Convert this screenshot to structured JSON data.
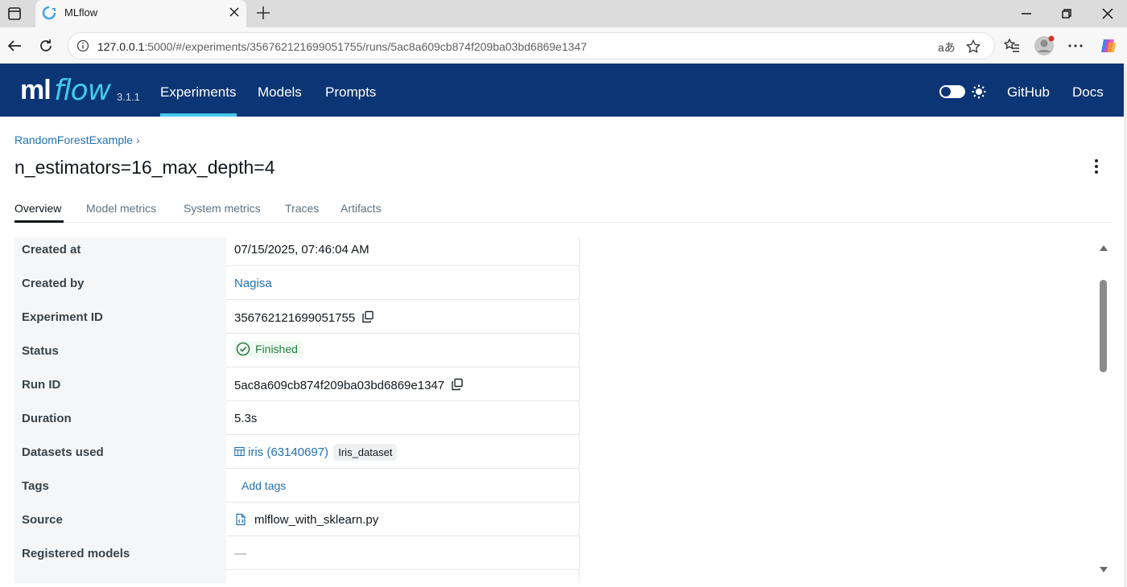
{
  "browser": {
    "tab_title": "MLflow",
    "url_host": "127.0.0.1",
    "url_rest": ":5000/#/experiments/356762121699051755/runs/5ac8a609cb874f209ba03bd6869e1347",
    "translate_label": "aあ"
  },
  "header": {
    "logo_ml": "ml",
    "logo_flow": "flow",
    "version": "3.1.1",
    "nav": [
      "Experiments",
      "Models",
      "Prompts"
    ],
    "links": {
      "github": "GitHub",
      "docs": "Docs"
    },
    "accent_color": "#43c9ed",
    "bg_color": "#0b3574"
  },
  "page": {
    "breadcrumb": "RandomForestExample",
    "breadcrumb_sep": "›",
    "title": "n_estimators=16_max_depth=4",
    "tabs": [
      "Overview",
      "Model metrics",
      "System metrics",
      "Traces",
      "Artifacts"
    ],
    "active_tab": "Overview"
  },
  "details": {
    "created_at": {
      "label": "Created at",
      "value": "07/15/2025, 07:46:04 AM"
    },
    "created_by": {
      "label": "Created by",
      "value": "Nagisa"
    },
    "experiment_id": {
      "label": "Experiment ID",
      "value": "356762121699051755"
    },
    "status": {
      "label": "Status",
      "value": "Finished",
      "color": "#277c43"
    },
    "run_id": {
      "label": "Run ID",
      "value": "5ac8a609cb874f209ba03bd6869e1347"
    },
    "duration": {
      "label": "Duration",
      "value": "5.3s"
    },
    "datasets": {
      "label": "Datasets used",
      "dataset_name": "iris (63140697)",
      "dataset_tag": "Iris_dataset"
    },
    "tags": {
      "label": "Tags",
      "action": "Add tags"
    },
    "source": {
      "label": "Source",
      "value": "mlflow_with_sklearn.py"
    },
    "registered_models": {
      "label": "Registered models",
      "value": "—"
    }
  }
}
